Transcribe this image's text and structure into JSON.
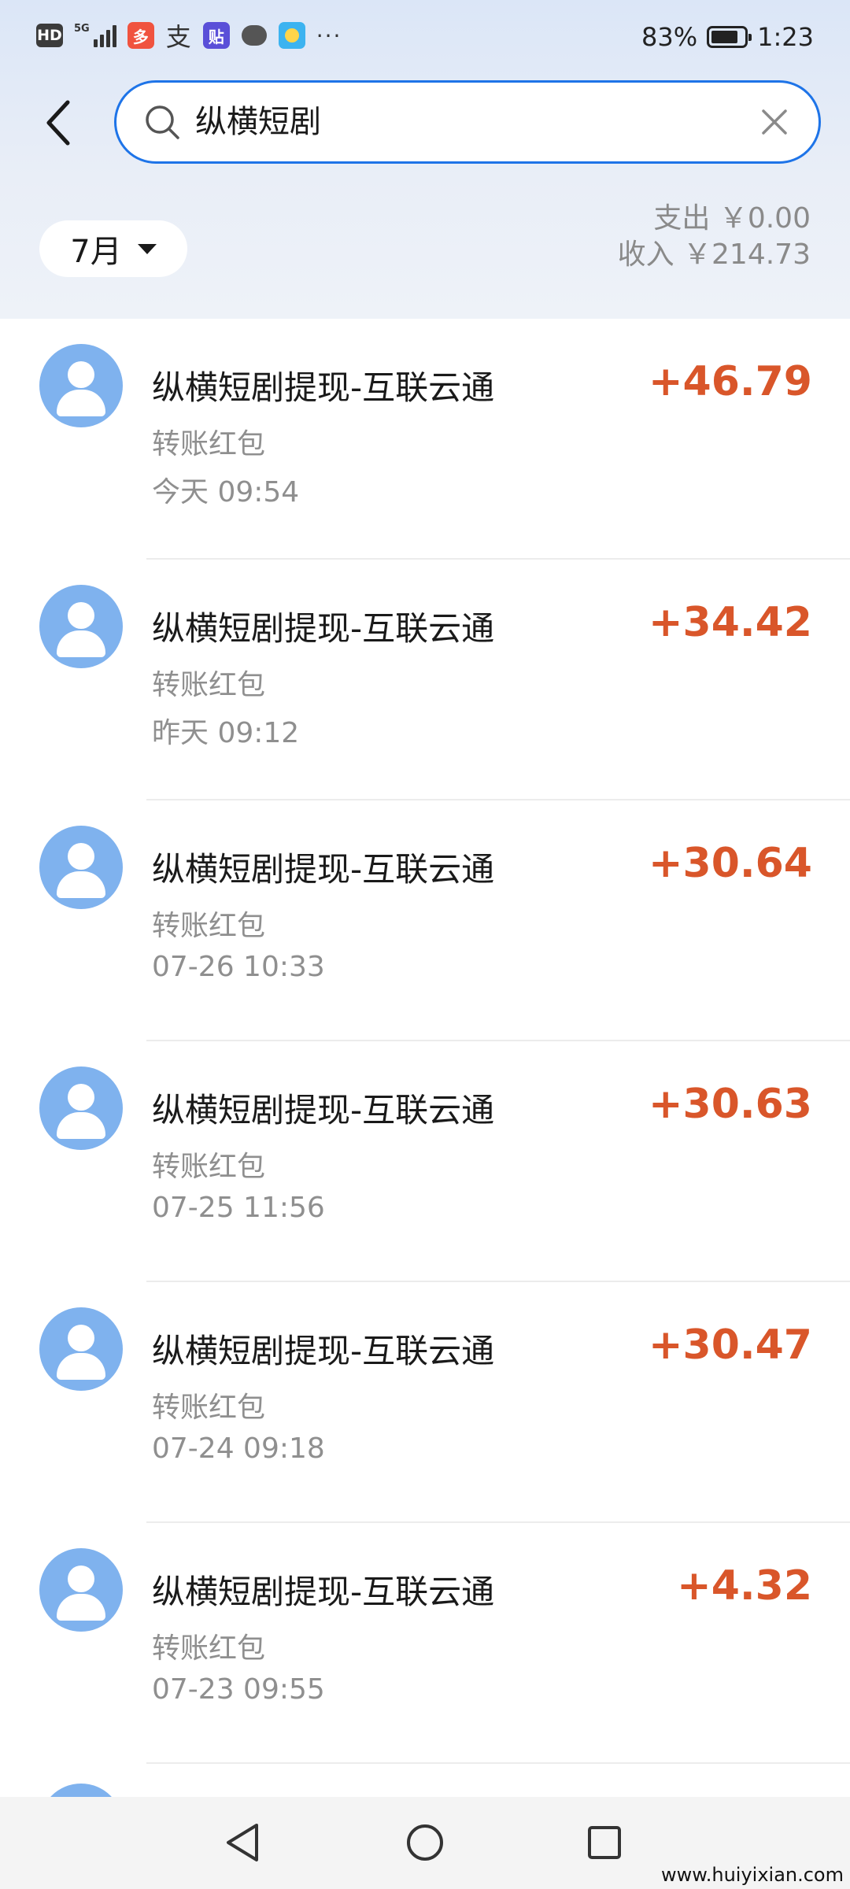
{
  "status_bar": {
    "hd": "HD",
    "network": "5G",
    "battery_percent": "83%",
    "battery_level": 0.83,
    "time": "1:23",
    "more": "···",
    "icons": [
      "hd-icon",
      "signal-icon",
      "pinduoduo-icon",
      "alipay-icon",
      "tieba-icon",
      "message-icon",
      "weather-icon"
    ]
  },
  "search": {
    "value": "纵横短剧"
  },
  "filter": {
    "month_label": "7月"
  },
  "summary": {
    "expense": "支出 ￥0.00",
    "income": "收入 ￥214.73"
  },
  "transactions": [
    {
      "title": "纵横短剧提现-互联云通",
      "type": "转账红包",
      "time": "今天 09:54",
      "amount": "+46.79"
    },
    {
      "title": "纵横短剧提现-互联云通",
      "type": "转账红包",
      "time": "昨天 09:12",
      "amount": "+34.42"
    },
    {
      "title": "纵横短剧提现-互联云通",
      "type": "转账红包",
      "time": "07-26 10:33",
      "amount": "+30.64"
    },
    {
      "title": "纵横短剧提现-互联云通",
      "type": "转账红包",
      "time": "07-25 11:56",
      "amount": "+30.63"
    },
    {
      "title": "纵横短剧提现-互联云通",
      "type": "转账红包",
      "time": "07-24 09:18",
      "amount": "+30.47"
    },
    {
      "title": "纵横短剧提现-互联云通",
      "type": "转账红包",
      "time": "07-23 09:55",
      "amount": "+4.32"
    }
  ],
  "colors": {
    "accent_blue": "#1e74e8",
    "income_red": "#d9562a",
    "avatar_blue": "#7fb2ee",
    "secondary_text": "#8f8f8f"
  },
  "watermark": "www.huiyixian.com"
}
